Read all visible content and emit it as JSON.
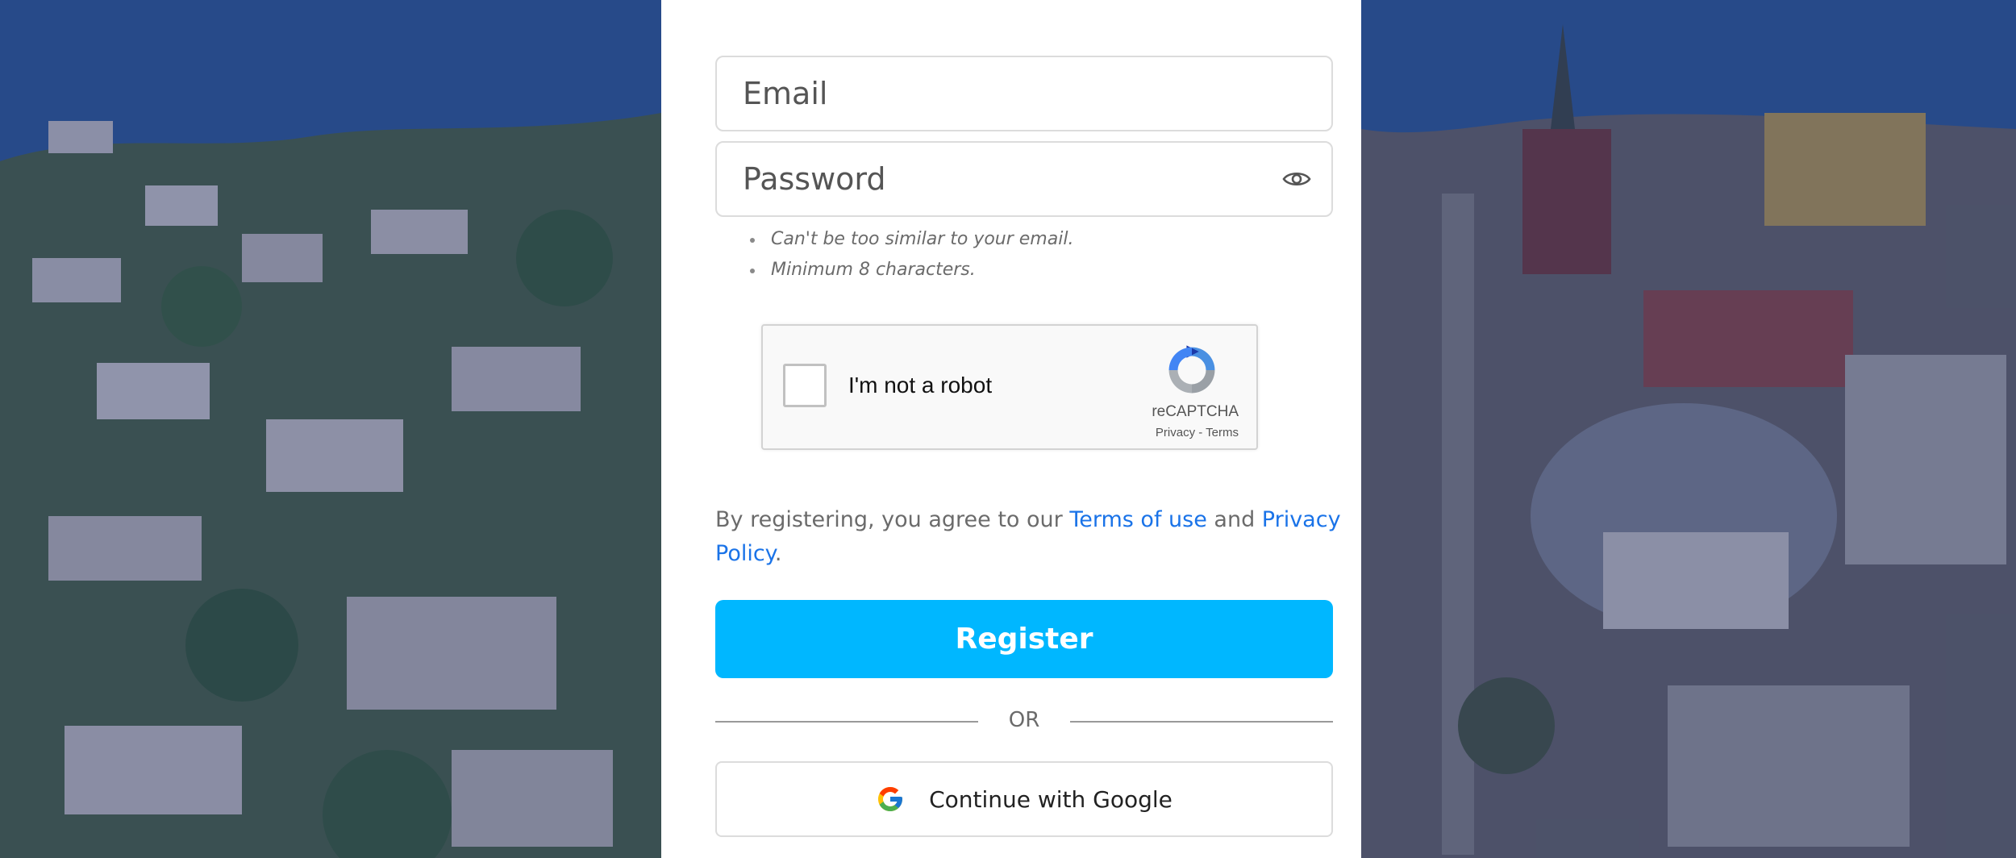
{
  "form": {
    "email_placeholder": "Email",
    "password_placeholder": "Password",
    "password_hints": [
      "Can't be too similar to your email.",
      "Minimum 8 characters."
    ]
  },
  "captcha": {
    "label": "I'm not a robot",
    "brand": "reCAPTCHA",
    "privacy": "Privacy",
    "separator": " - ",
    "terms": "Terms"
  },
  "legal": {
    "prefix": "By registering, you agree to our ",
    "terms_link": "Terms of use",
    "middle": " and ",
    "privacy_link": "Privacy Policy",
    "suffix": "."
  },
  "actions": {
    "register_label": "Register",
    "divider_text": "OR",
    "google_label": "Continue with Google"
  },
  "icons": {
    "password_toggle": "eye-icon",
    "captcha_logo": "recaptcha-icon",
    "google_logo": "google-icon"
  },
  "colors": {
    "primary_button": "#00b7ff",
    "link": "#1a73e8",
    "background_tint": "#1e2d6e"
  }
}
